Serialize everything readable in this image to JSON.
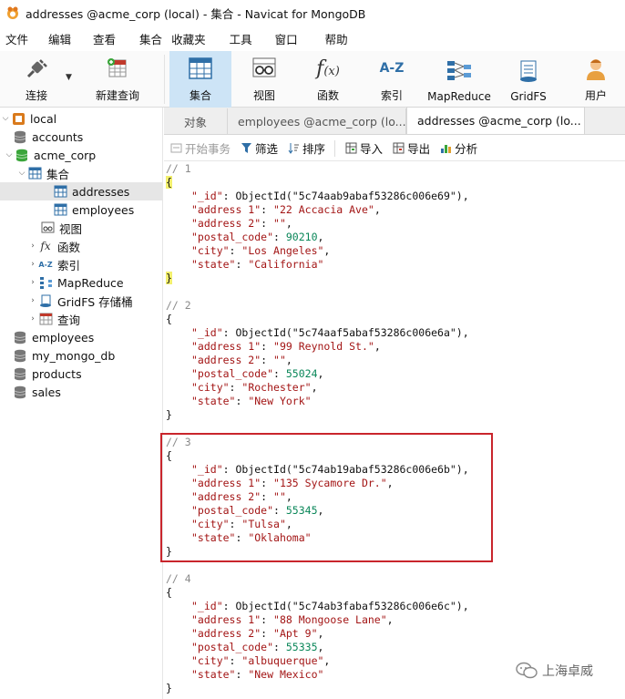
{
  "window": {
    "title": "addresses @acme_corp (local) - 集合 - Navicat for MongoDB"
  },
  "menu": [
    "文件",
    "编辑",
    "查看",
    "集合",
    "收藏夹",
    "工具",
    "窗口",
    "帮助"
  ],
  "toolbar": {
    "connect": "连接",
    "new_query": "新建查询",
    "collection": "集合",
    "view": "视图",
    "function": "函数",
    "index": "索引",
    "mapreduce": "MapReduce",
    "gridfs": "GridFS",
    "user": "用户"
  },
  "tree": {
    "local": "local",
    "accounts": "accounts",
    "acme_corp": "acme_corp",
    "collections": "集合",
    "addresses": "addresses",
    "employees": "employees",
    "views": "视图",
    "functions": "函数",
    "indexes": "索引",
    "mapreduce": "MapReduce",
    "gridfs": "GridFS 存储桶",
    "queries": "查询",
    "db_employees": "employees",
    "my_mongo_db": "my_mongo_db",
    "products": "products",
    "sales": "sales"
  },
  "tabs": {
    "objects": "对象",
    "employees_tab": "employees @acme_corp (lo...",
    "addresses_tab": "addresses @acme_corp (lo..."
  },
  "subtoolbar": {
    "begin_transaction": "开始事务",
    "filter": "筛选",
    "sort": "排序",
    "import": "导入",
    "export": "导出",
    "analyze": "分析"
  },
  "documents": [
    {
      "comment": "// 1",
      "id": "ObjectId(\"5c74aab9abaf53286c006e69\")",
      "address1": "\"22 Accacia Ave\"",
      "address2": "\"\"",
      "postal_code": "90210",
      "city": "\"Los Angeles\"",
      "state": "\"California\""
    },
    {
      "comment": "// 2",
      "id": "ObjectId(\"5c74aaf5abaf53286c006e6a\")",
      "address1": "\"99 Reynold St.\"",
      "address2": "\"\"",
      "postal_code": "55024",
      "city": "\"Rochester\"",
      "state": "\"New York\""
    },
    {
      "comment": "// 3",
      "id": "ObjectId(\"5c74ab19abaf53286c006e6b\")",
      "address1": "\"135 Sycamore Dr.\"",
      "address2": "\"\"",
      "postal_code": "55345",
      "city": "\"Tulsa\"",
      "state": "\"Oklahoma\""
    },
    {
      "comment": "// 4",
      "id": "ObjectId(\"5c74ab3fabaf53286c006e6c\")",
      "address1": "\"88 Mongoose Lane\"",
      "address2": "\"Apt 9\"",
      "postal_code": "55335",
      "city": "\"albuquerque\"",
      "state": "\"New Mexico\""
    }
  ],
  "keys": {
    "id": "\"_id\"",
    "address1": "\"address 1\"",
    "address2": "\"address 2\"",
    "postal_code": "\"postal_code\"",
    "city": "\"city\"",
    "state": "\"state\""
  },
  "watermark": "上海卓威",
  "colors": {
    "active_toolbar": "#cde4f6",
    "highlight_border": "#c9252c",
    "string": "#a31515",
    "number": "#098658"
  }
}
